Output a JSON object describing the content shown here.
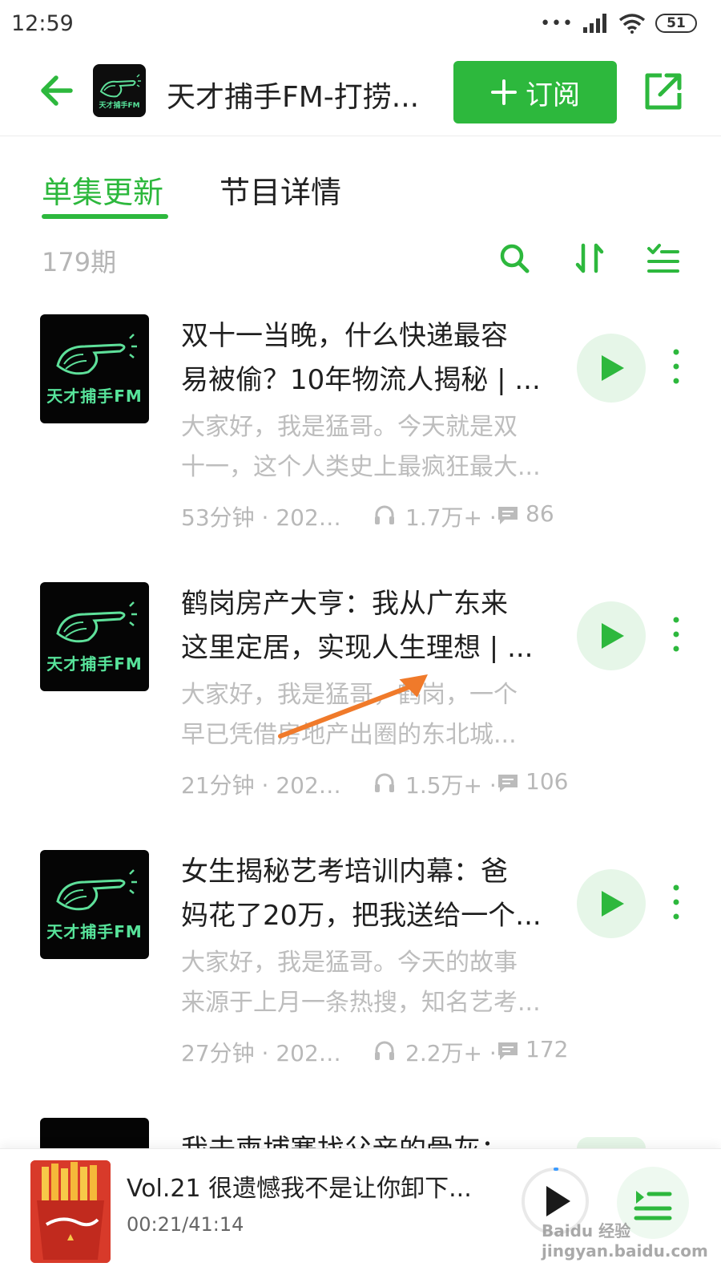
{
  "status_bar": {
    "time": "12:59",
    "battery": "51"
  },
  "header": {
    "title": "天才捕手FM-打捞...",
    "subscribe_label": "订阅",
    "cover_brand": "天才捕手FM"
  },
  "tabs": [
    {
      "label": "单集更新",
      "active": true
    },
    {
      "label": "节目详情",
      "active": false
    }
  ],
  "list_header": {
    "episode_count": "179期"
  },
  "episodes": [
    {
      "title_line1": "双十一当晚，什么快递最容",
      "title_line2": "易被偷？10年物流人揭秘 | ...",
      "desc_line1": "大家好，我是猛哥。今天就是双",
      "desc_line2": "十一，这个人类史上最疯狂最大...",
      "duration_date": "53分钟 · 2022/...",
      "plays": "1.7万+ ·",
      "comments": "86",
      "cover_brand": "天才捕手FM"
    },
    {
      "title_line1": "鹤岗房产大亨：我从广东来",
      "title_line2": "这里定居，实现人生理想 | ...",
      "desc_line1": "大家好，我是猛哥，鹤岗，一个",
      "desc_line2": "早已凭借房地产出圈的东北城...",
      "duration_date": "21分钟 · 2022...",
      "plays": "1.5万+ ·",
      "comments": "106",
      "cover_brand": "天才捕手FM"
    },
    {
      "title_line1": "女生揭秘艺考培训内幕：爸",
      "title_line2": "妈花了20万，把我送给一个...",
      "desc_line1": "大家好，我是猛哥。今天的故事",
      "desc_line2": "来源于上月一条热搜，知名艺考...",
      "duration_date": "27分钟 · 2022...",
      "plays": "2.2万+ ·",
      "comments": "172",
      "cover_brand": "天才捕手FM"
    }
  ],
  "partial_episode": {
    "title": "我去柬埔寨找父亲的骨灰："
  },
  "mini_player": {
    "title": "Vol.21 很遗憾我不是让你卸下...",
    "time": "00:21/41:14",
    "progress": 0.0085
  },
  "watermark": "Baidu 经验 jingyan.baidu.com",
  "colors": {
    "accent": "#2db83d",
    "annotation_arrow": "#f07a2a"
  }
}
